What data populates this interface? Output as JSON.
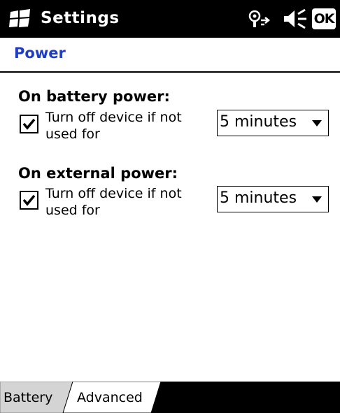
{
  "title_bar": {
    "app_title": "Settings",
    "icons": [
      "windows-start-icon",
      "connectivity-icon",
      "volume-icon"
    ],
    "ok_label": "OK"
  },
  "page": {
    "title": "Power",
    "title_color": "#1f3cc4"
  },
  "sections": [
    {
      "heading": "On battery power:",
      "checkbox_checked": true,
      "option_label": "Turn off device if not used for",
      "dropdown_value": "5 minutes"
    },
    {
      "heading": "On external power:",
      "checkbox_checked": true,
      "option_label": "Turn off device if not used for",
      "dropdown_value": "5 minutes"
    }
  ],
  "tabs": [
    {
      "label": "Battery",
      "active": false
    },
    {
      "label": "Advanced",
      "active": true
    }
  ]
}
